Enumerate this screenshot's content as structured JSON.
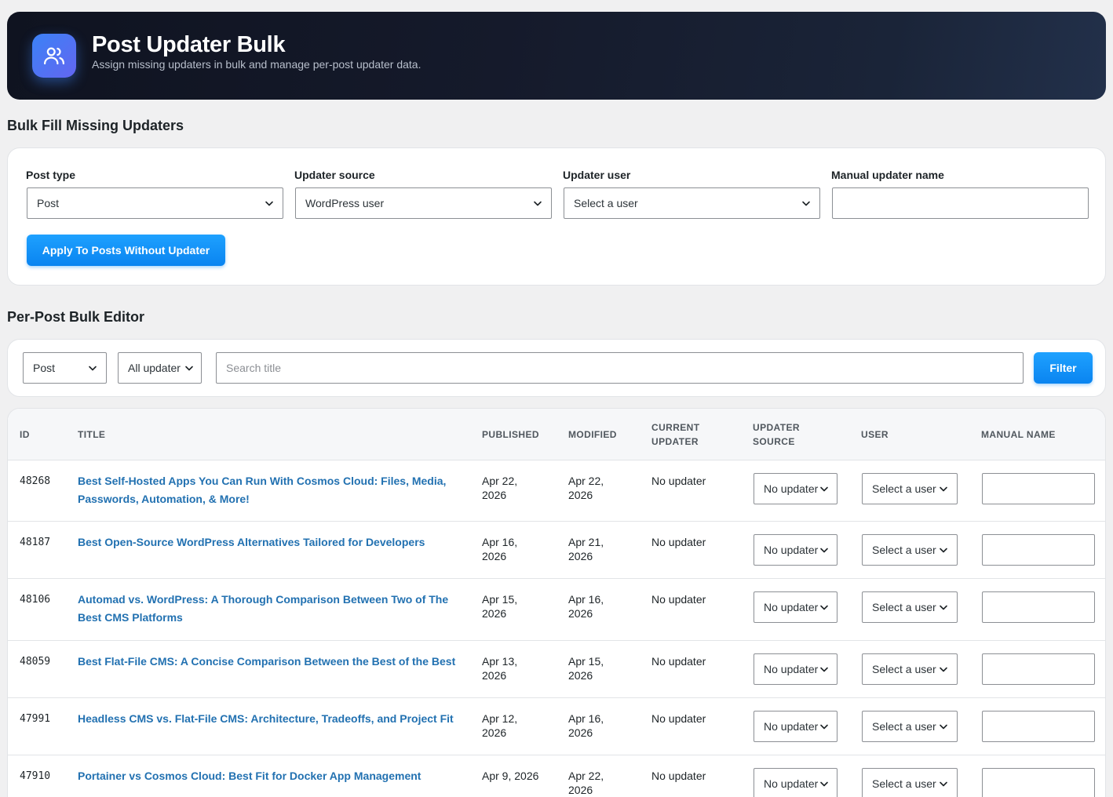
{
  "header": {
    "title": "Post Updater Bulk",
    "subtitle": "Assign missing updaters in bulk and manage per-post updater data.",
    "icon": "users-icon",
    "accent": "#3b82f6"
  },
  "bulk_fill": {
    "section_title": "Bulk Fill Missing Updaters",
    "post_type_label": "Post type",
    "post_type_value": "Post",
    "updater_source_label": "Updater source",
    "updater_source_value": "WordPress user",
    "updater_user_label": "Updater user",
    "updater_user_value": "Select a user",
    "manual_name_label": "Manual updater name",
    "manual_name_value": "",
    "apply_button": "Apply To Posts Without Updater"
  },
  "editor": {
    "section_title": "Per-Post Bulk Editor",
    "filter_post_type": "Post",
    "filter_updater": "All updater",
    "search_placeholder": "Search title",
    "filter_button": "Filter"
  },
  "table": {
    "headers": {
      "id": "ID",
      "title": "TITLE",
      "published": "PUBLISHED",
      "modified": "MODIFIED",
      "current_updater_1": "CURRENT",
      "current_updater_2": "UPDATER",
      "updater_source_1": "UPDATER",
      "updater_source_2": "SOURCE",
      "user": "USER",
      "manual_name": "MANUAL NAME"
    },
    "rows": [
      {
        "id": "48268",
        "title": "Best Self-Hosted Apps You Can Run With Cosmos Cloud: Files, Media, Passwords, Automation, & More!",
        "published_1": "Apr 22,",
        "published_2": "2026",
        "modified_1": "Apr 22,",
        "modified_2": "2026",
        "current": "No updater",
        "source": "No updater",
        "user": "Select a user",
        "manual": ""
      },
      {
        "id": "48187",
        "title": "Best Open-Source WordPress Alternatives Tailored for Developers",
        "published_1": "Apr 16,",
        "published_2": "2026",
        "modified_1": "Apr 21,",
        "modified_2": "2026",
        "current": "No updater",
        "source": "No updater",
        "user": "Select a user",
        "manual": ""
      },
      {
        "id": "48106",
        "title": "Automad vs. WordPress: A Thorough Comparison Between Two of The Best CMS Platforms",
        "published_1": "Apr 15,",
        "published_2": "2026",
        "modified_1": "Apr 16,",
        "modified_2": "2026",
        "current": "No updater",
        "source": "No updater",
        "user": "Select a user",
        "manual": ""
      },
      {
        "id": "48059",
        "title": "Best Flat-File CMS: A Concise Comparison Between the Best of the Best",
        "published_1": "Apr 13,",
        "published_2": "2026",
        "modified_1": "Apr 15,",
        "modified_2": "2026",
        "current": "No updater",
        "source": "No updater",
        "user": "Select a user",
        "manual": ""
      },
      {
        "id": "47991",
        "title": "Headless CMS vs. Flat-File CMS: Architecture, Tradeoffs, and Project Fit",
        "published_1": "Apr 12,",
        "published_2": "2026",
        "modified_1": "Apr 16,",
        "modified_2": "2026",
        "current": "No updater",
        "source": "No updater",
        "user": "Select a user",
        "manual": ""
      },
      {
        "id": "47910",
        "title": "Portainer vs Cosmos Cloud: Best Fit for Docker App Management",
        "published_1": "Apr 9, 2026",
        "published_2": "",
        "modified_1": "Apr 22,",
        "modified_2": "2026",
        "current": "No updater",
        "source": "No updater",
        "user": "Select a user",
        "manual": ""
      }
    ]
  }
}
